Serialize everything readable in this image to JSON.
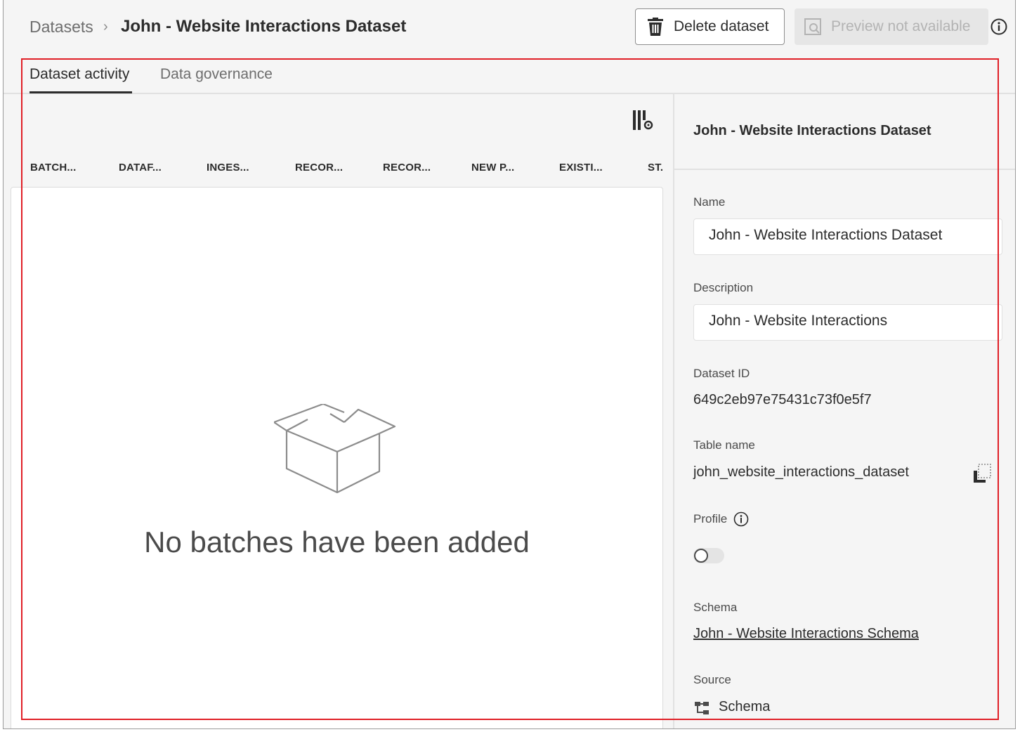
{
  "breadcrumb": {
    "parent": "Datasets",
    "separator": "›",
    "current": "John - Website Interactions Dataset"
  },
  "actions": {
    "delete_label": "Delete dataset",
    "preview_label": "Preview not available"
  },
  "tabs": [
    {
      "label": "Dataset activity",
      "active": true
    },
    {
      "label": "Data governance",
      "active": false
    }
  ],
  "table": {
    "columns": [
      "BATCH...",
      "DATAF...",
      "INGES...",
      "RECOR...",
      "RECOR...",
      "NEW P...",
      "EXISTI...",
      "ST."
    ],
    "empty_message": "No batches have been added"
  },
  "details": {
    "title": "John - Website Interactions Dataset",
    "name_label": "Name",
    "name_value": "John - Website Interactions Dataset",
    "description_label": "Description",
    "description_value": "John - Website Interactions",
    "dataset_id_label": "Dataset ID",
    "dataset_id_value": "649c2eb97e75431c73f0e5f7",
    "table_name_label": "Table name",
    "table_name_value": "john_website_interactions_dataset",
    "profile_label": "Profile",
    "profile_enabled": false,
    "schema_label": "Schema",
    "schema_value": "John - Website Interactions Schema",
    "source_label": "Source",
    "source_value": "Schema"
  },
  "icons": {
    "delete": "trash-icon",
    "preview": "preview-icon",
    "info": "info-icon",
    "settings": "column-settings-icon",
    "empty": "open-box-icon",
    "copy": "copy-icon",
    "source": "schema-tree-icon"
  },
  "colors": {
    "highlight": "#e01f26",
    "background": "#f5f5f5"
  }
}
